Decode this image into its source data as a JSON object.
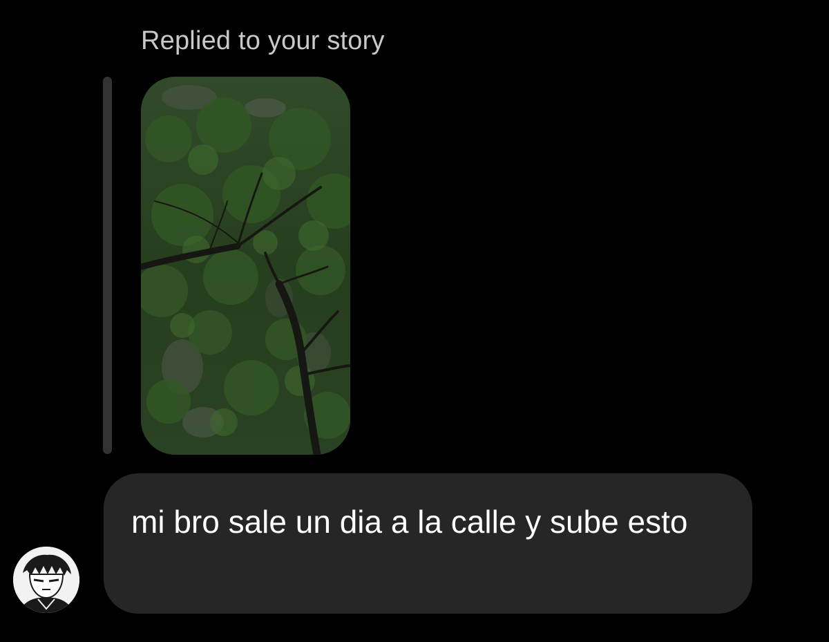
{
  "conversation": {
    "reply_label": "Replied to your story",
    "story_image": {
      "icon": "story-thumbnail",
      "subject": "tree canopy"
    },
    "message": {
      "text": "mi bro sale un dia a la calle y sube esto"
    },
    "sender_avatar": {
      "icon": "avatar-icon"
    }
  },
  "colors": {
    "background": "#000000",
    "bubble": "#262626",
    "reply_bar": "#333333",
    "muted_text": "#c9c9c9",
    "text": "#ffffff"
  }
}
